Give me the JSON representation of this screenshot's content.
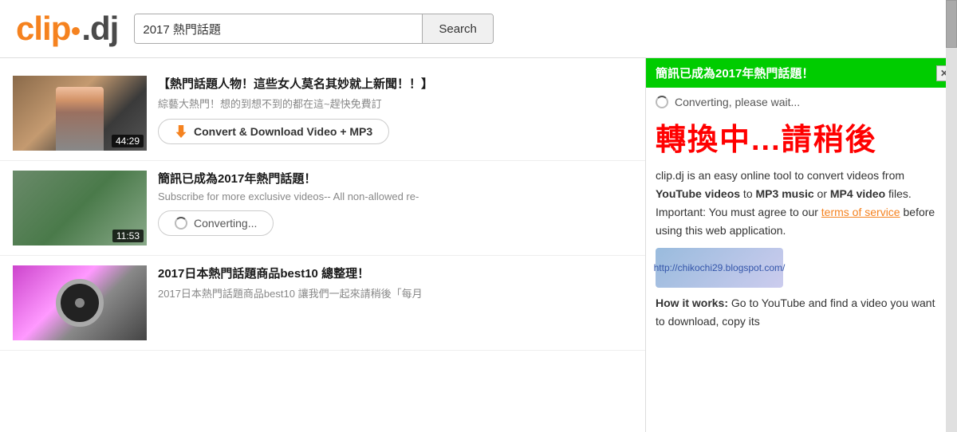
{
  "header": {
    "logo_clip": "clip",
    "logo_dj": ".dj",
    "search_value": "2017 熱門話題",
    "search_button": "Search"
  },
  "results": [
    {
      "id": 1,
      "title": "【熱門話題人物！這些女人莫名其妙就上新聞！！】",
      "description": "綜藝大熱門！想的到想不到的都在這~趕快免費訂",
      "duration": "44:29",
      "button_type": "convert",
      "button_label": "Convert & Download Video + MP3",
      "thumb_type": "person"
    },
    {
      "id": 2,
      "title": "簡訊已成為2017年熱門話題！",
      "description": "Subscribe for more exclusive videos-- All non-allowed re-",
      "duration": "11:53",
      "button_type": "converting",
      "button_label": "Converting...",
      "thumb_type": "bike"
    },
    {
      "id": 3,
      "title": "2017日本熱門話題商品best10 總整理！",
      "description": "2017日本熱門話題商品best10 讓我們一起來請稍後「每月",
      "duration": "",
      "button_type": "none",
      "button_label": "",
      "thumb_type": "disc"
    }
  ],
  "right_panel": {
    "notification_text": "簡訊已成為2017年熱門話題！",
    "converting_status": "Converting, please wait...",
    "converting_big_text": "轉換中...請稍後",
    "description_parts": [
      "clip.dj is an easy online tool to convert videos from ",
      "YouTube videos",
      " to ",
      "MP3 music",
      " or ",
      "MP4 video",
      " files. Important: You must agree to our ",
      "terms of service",
      " before using this web application."
    ],
    "terms_link": "terms of service",
    "how_it_works_title": "How it works:",
    "how_it_works_text": "Go to YouTube and find a video you want to download, copy its"
  }
}
